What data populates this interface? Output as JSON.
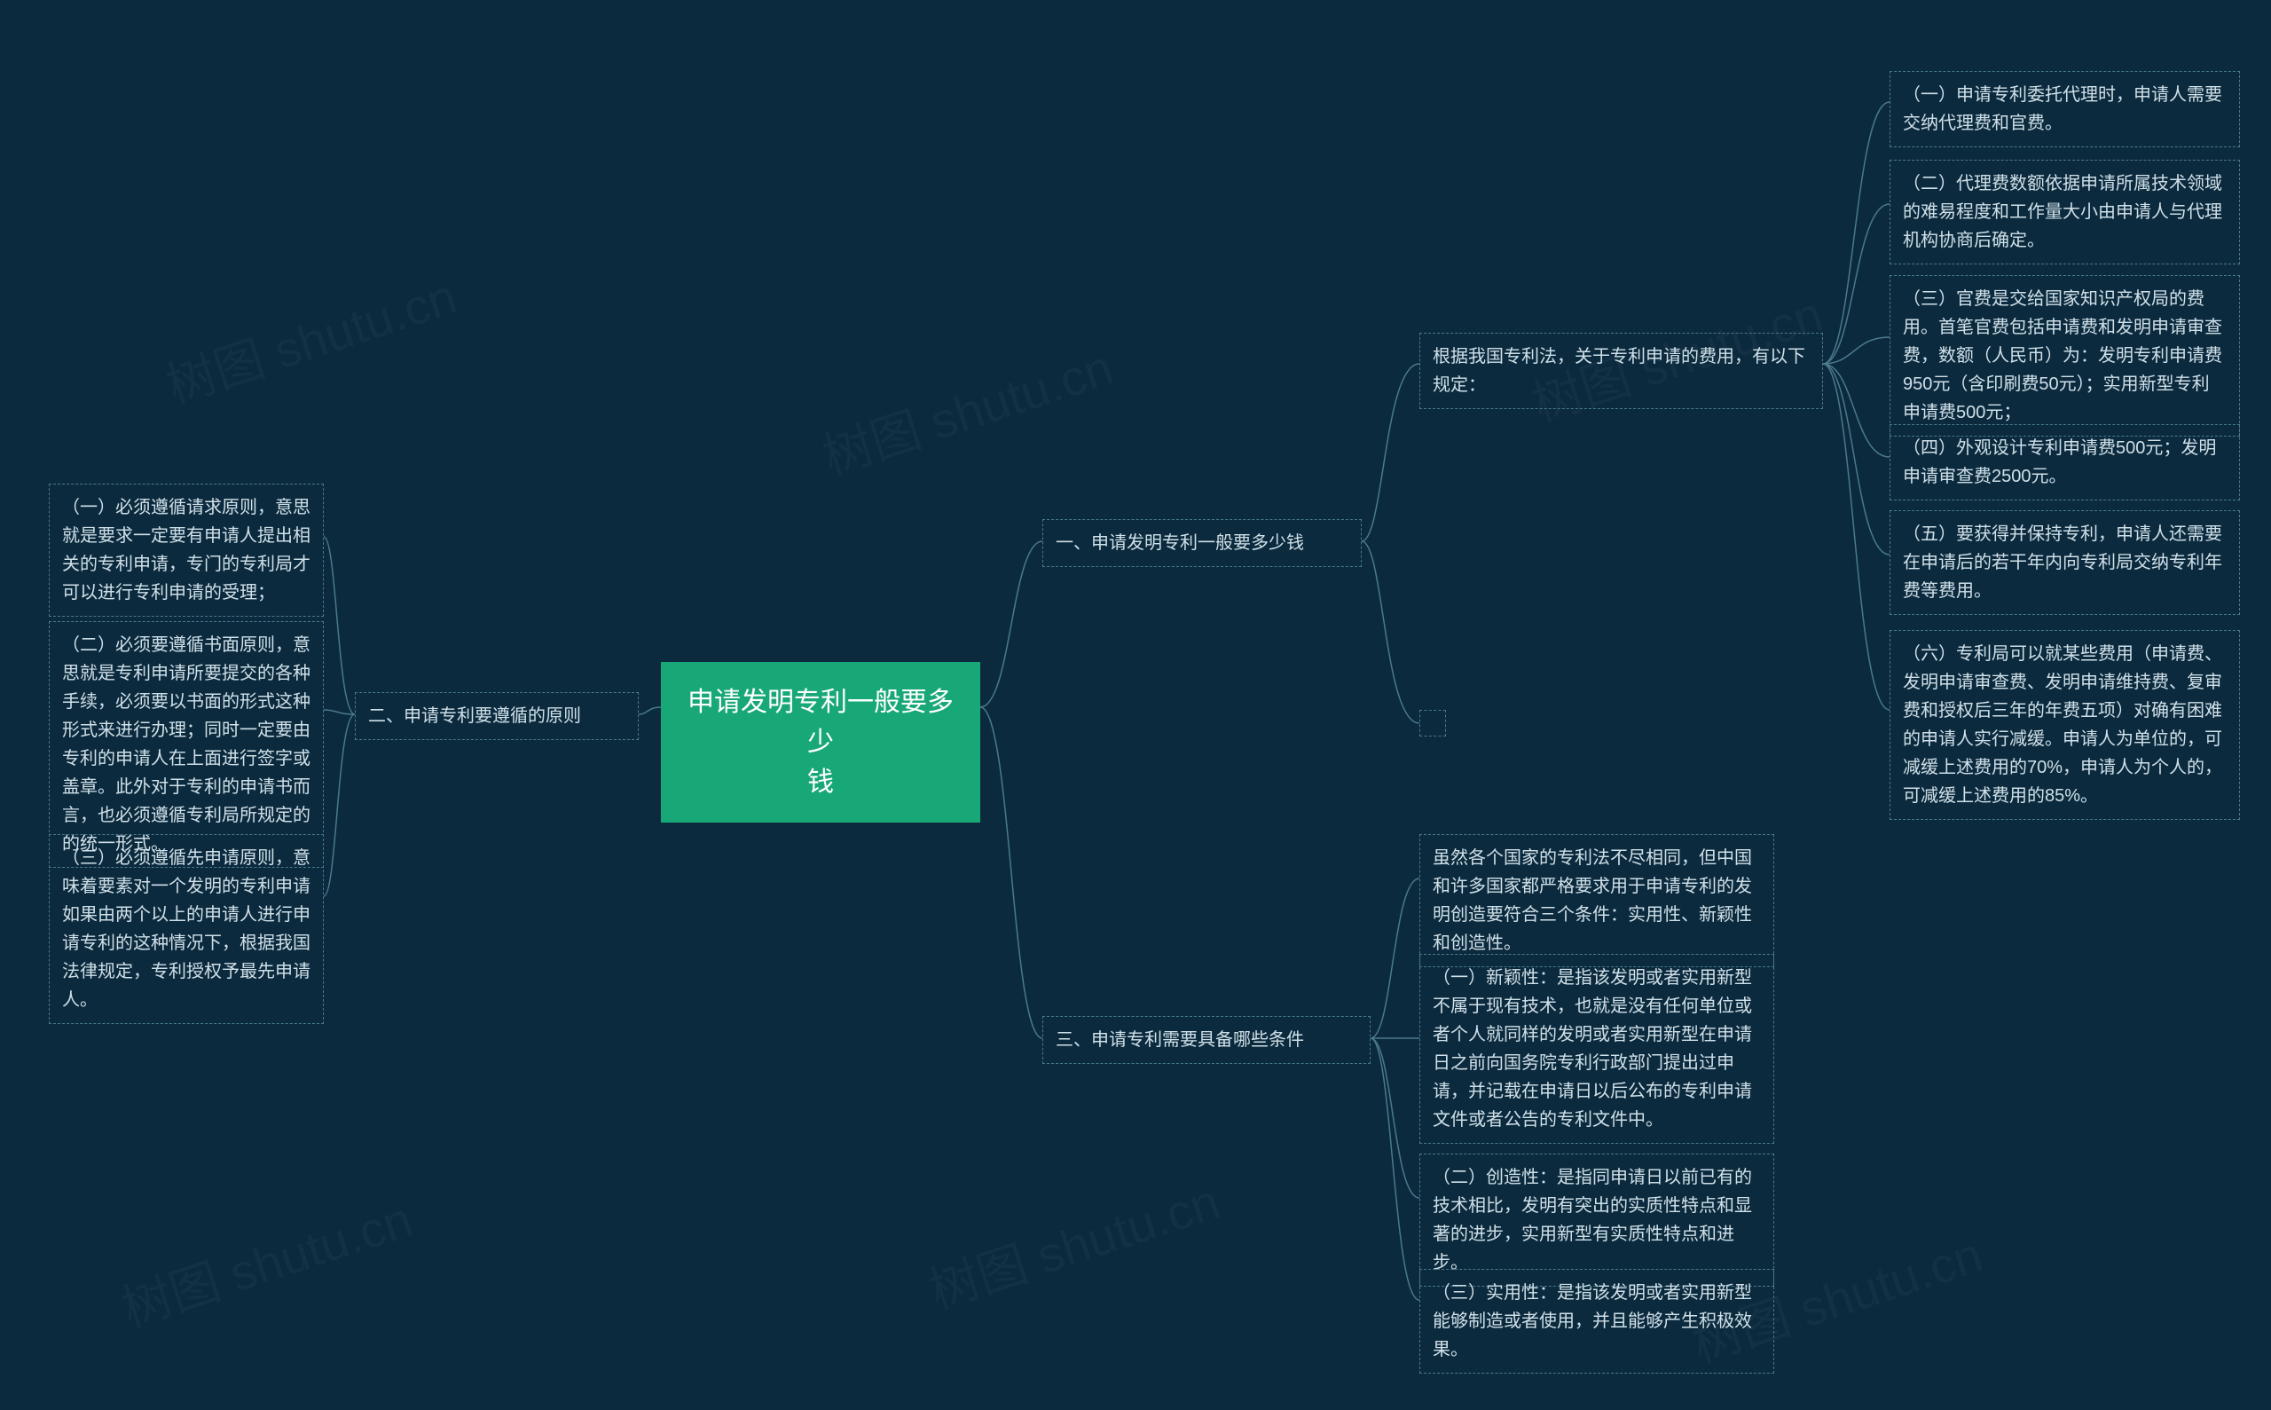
{
  "root": {
    "title": "申请发明专利一般要多少\n钱"
  },
  "branches": {
    "b1": {
      "title": "一、申请发明专利一般要多少钱"
    },
    "b2": {
      "title": "二、申请专利要遵循的原则"
    },
    "b3": {
      "title": "三、申请专利需要具备哪些条件"
    }
  },
  "b1_sub": {
    "intro": "根据我国专利法，关于专利申请的费用，有以下规定：",
    "i1": "（一）申请专利委托代理时，申请人需要交纳代理费和官费。",
    "i2": "（二）代理费数额依据申请所属技术领域的难易程度和工作量大小由申请人与代理机构协商后确定。",
    "i3": "（三）官费是交给国家知识产权局的费用。首笔官费包括申请费和发明申请审查费，数额（人民币）为：发明专利申请费950元（含印刷费50元）；实用新型专利申请费500元；",
    "i4": "（四）外观设计专利申请费500元；发明申请审查费2500元。",
    "i5": "（五）要获得并保持专利，申请人还需要在申请后的若干年内向专利局交纳专利年费等费用。",
    "i6": "（六）专利局可以就某些费用（申请费、发明申请审查费、发明申请维持费、复审费和授权后三年的年费五项）对确有困难的申请人实行减缓。申请人为单位的，可减缓上述费用的70%，申请人为个人的，可减缓上述费用的85%。"
  },
  "b2_sub": {
    "i1": "（一）必须遵循请求原则，意思就是要求一定要有申请人提出相关的专利申请，专门的专利局才可以进行专利申请的受理；",
    "i2": "（二）必须要遵循书面原则，意思就是专利申请所要提交的各种手续，必须要以书面的形式这种形式来进行办理；同时一定要由专利的申请人在上面进行签字或盖章。此外对于专利的申请书而言，也必须遵循专利局所规定的的统一形式。",
    "i3": "（三）必须遵循先申请原则，意味着要素对一个发明的专利申请如果由两个以上的申请人进行申请专利的这种情况下，根据我国法律规定，专利授权予最先申请人。"
  },
  "b3_sub": {
    "intro": "虽然各个国家的专利法不尽相同，但中国和许多国家都严格要求用于申请专利的发明创造要符合三个条件：实用性、新颖性和创造性。",
    "i1": "（一）新颖性：是指该发明或者实用新型不属于现有技术，也就是没有任何单位或者个人就同样的发明或者实用新型在申请日之前向国务院专利行政部门提出过申请，并记载在申请日以后公布的专利申请文件或者公告的专利文件中。",
    "i2": "（二）创造性：是指同申请日以前已有的技术相比，发明有突出的实质性特点和显著的进步，实用新型有实质性特点和进步。",
    "i3": "（三）实用性：是指该发明或者实用新型能够制造或者使用，并且能够产生积极效果。"
  },
  "watermark": "树图 shutu.cn"
}
